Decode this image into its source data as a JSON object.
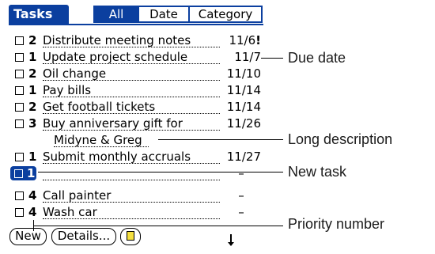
{
  "app": {
    "title": "Tasks",
    "tabs": [
      {
        "label": "All",
        "selected": true
      },
      {
        "label": "Date",
        "selected": false
      },
      {
        "label": "Category",
        "selected": false
      }
    ]
  },
  "tasks": [
    {
      "priority": "2",
      "description": "Distribute meeting notes",
      "due": "11/6",
      "alarm": "!"
    },
    {
      "priority": "1",
      "description": "Update project schedule",
      "due": "11/7"
    },
    {
      "priority": "2",
      "description": "Oil change",
      "due": "11/10"
    },
    {
      "priority": "1",
      "description": "Pay bills",
      "due": "11/14"
    },
    {
      "priority": "2",
      "description": "Get football tickets",
      "due": "11/14"
    },
    {
      "priority": "3",
      "description": "Buy anniversary gift for",
      "description_line2": "Midyne & Greg",
      "due": "11/26"
    },
    {
      "priority": "1",
      "description": "Submit monthly accruals",
      "due": "11/27"
    },
    {
      "priority": "1",
      "description": "",
      "due": "–",
      "is_new": true
    },
    {
      "priority": "4",
      "description": "Call painter",
      "due": "–"
    },
    {
      "priority": "4",
      "description": "Wash car",
      "due": "–"
    }
  ],
  "buttons": {
    "new": "New",
    "details": "Details..."
  },
  "callouts": {
    "due_date": "Due date",
    "long_description": "Long description",
    "new_task": "New task",
    "priority_number": "Priority number"
  },
  "colors": {
    "accent": "#0b3f9f",
    "note_icon": "#f5e040"
  }
}
